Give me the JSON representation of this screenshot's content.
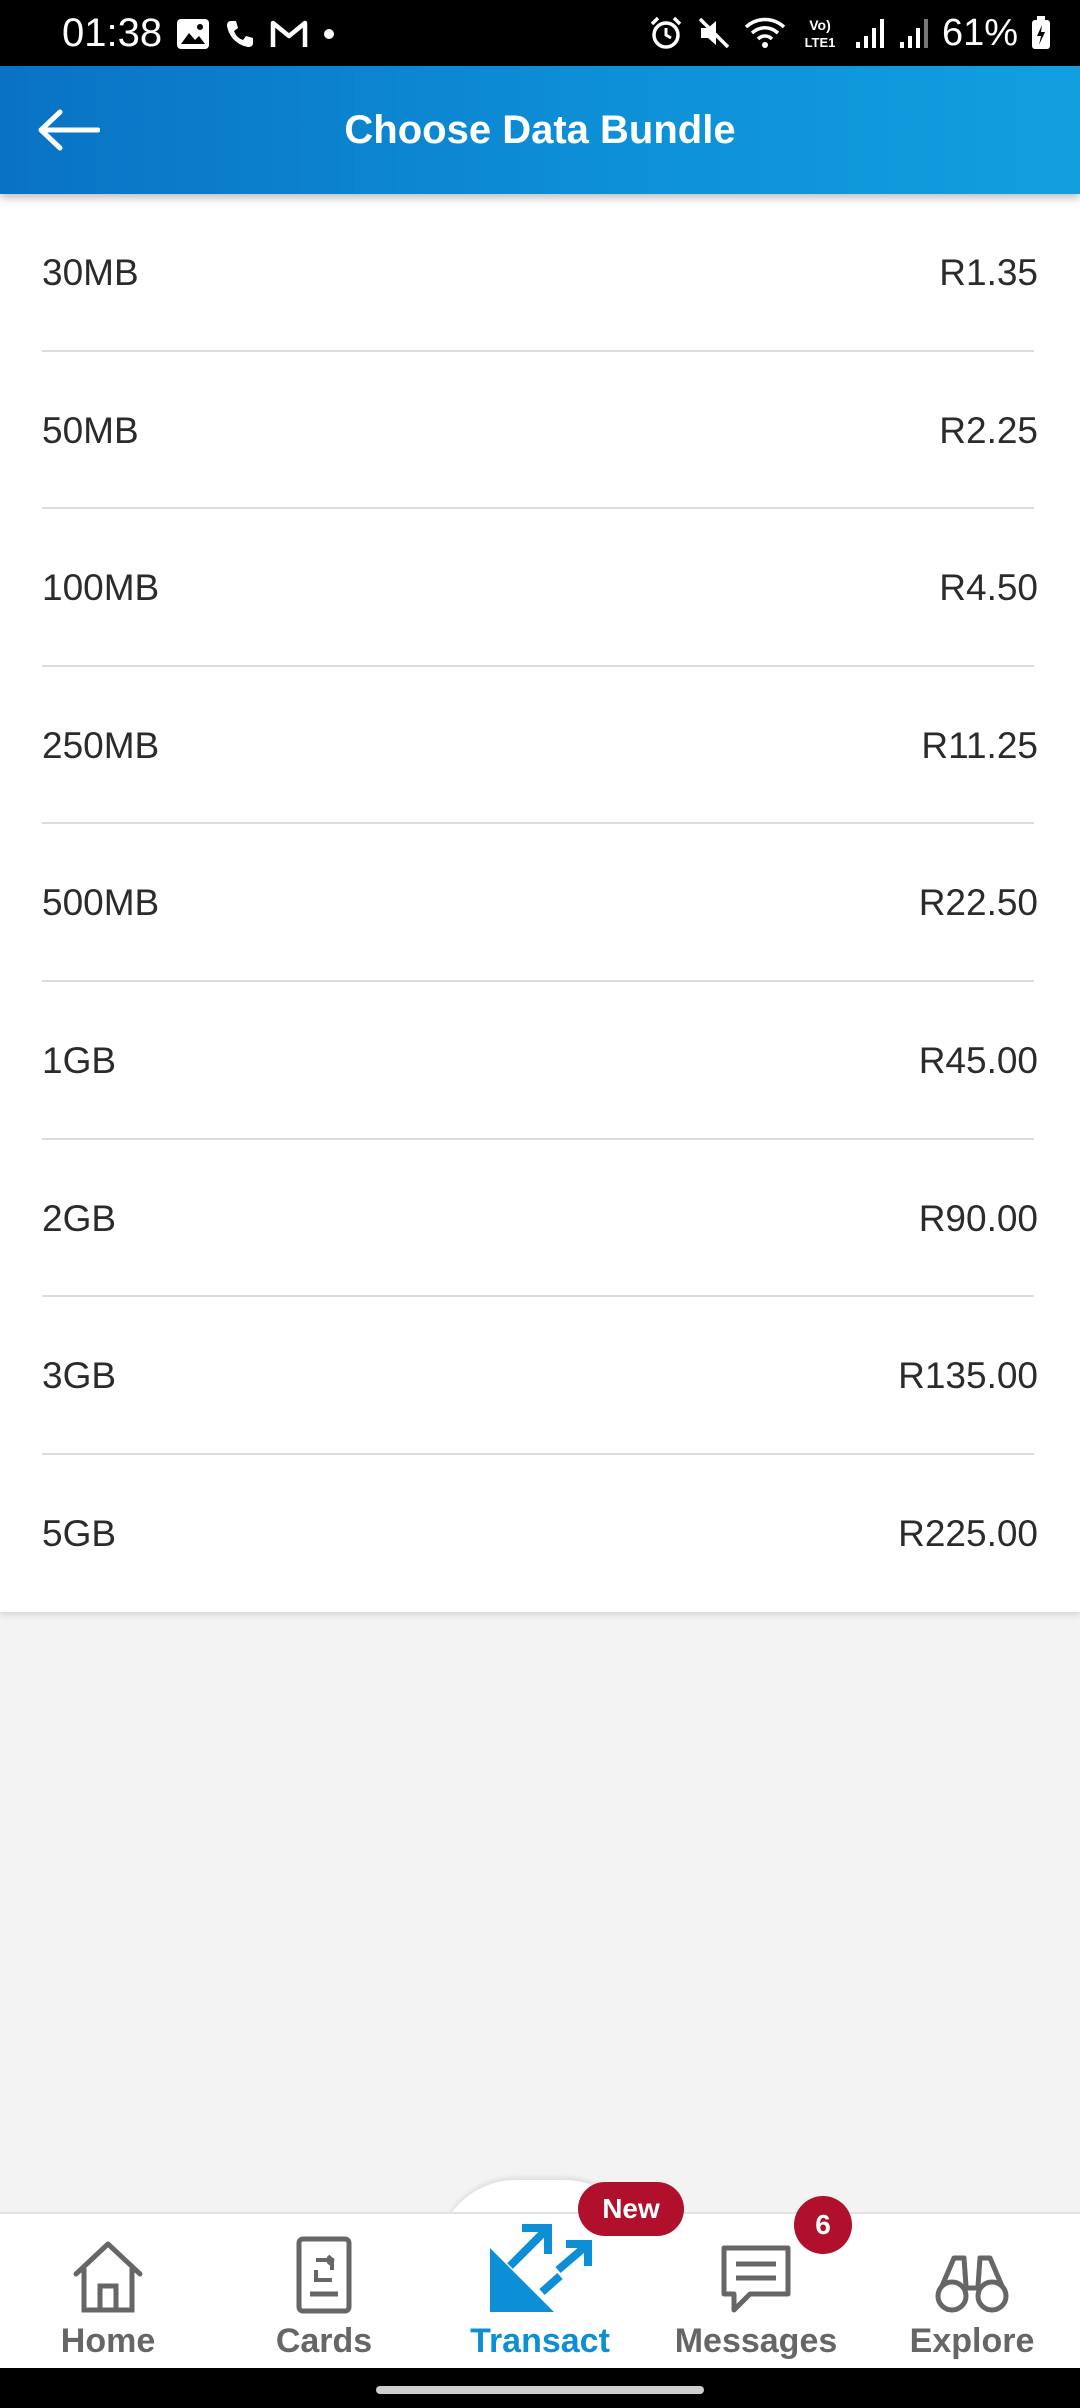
{
  "status_bar": {
    "time": "01:38",
    "battery": "61%",
    "icons_left": [
      "image-icon",
      "phone-icon",
      "gmail-icon",
      "dot-icon"
    ],
    "icons_right": [
      "alarm-icon",
      "mute-icon",
      "wifi-icon",
      "volte-icon",
      "signal-icon",
      "signal-icon",
      "battery-icon"
    ]
  },
  "app_bar": {
    "title": "Choose Data Bundle",
    "back_icon": "arrow-left-icon"
  },
  "bundles": [
    {
      "size": "30MB",
      "price": "R1.35"
    },
    {
      "size": "50MB",
      "price": "R2.25"
    },
    {
      "size": "100MB",
      "price": "R4.50"
    },
    {
      "size": "250MB",
      "price": "R11.25"
    },
    {
      "size": "500MB",
      "price": "R22.50"
    },
    {
      "size": "1GB",
      "price": "R45.00"
    },
    {
      "size": "2GB",
      "price": "R90.00"
    },
    {
      "size": "3GB",
      "price": "R135.00"
    },
    {
      "size": "5GB",
      "price": "R225.00"
    }
  ],
  "bottom_nav": {
    "items": [
      {
        "label": "Home",
        "icon": "home-icon"
      },
      {
        "label": "Cards",
        "icon": "cards-icon"
      },
      {
        "label": "Transact",
        "icon": "transact-icon",
        "active": true
      },
      {
        "label": "Messages",
        "icon": "messages-icon"
      },
      {
        "label": "Explore",
        "icon": "binoculars-icon"
      }
    ],
    "transact_badge": "New",
    "messages_badge": "6"
  },
  "colors": {
    "app_bar": "#0d8fd6",
    "active": "#0d8fd6",
    "badge": "#b0102b",
    "background": "#f3f3f3"
  }
}
